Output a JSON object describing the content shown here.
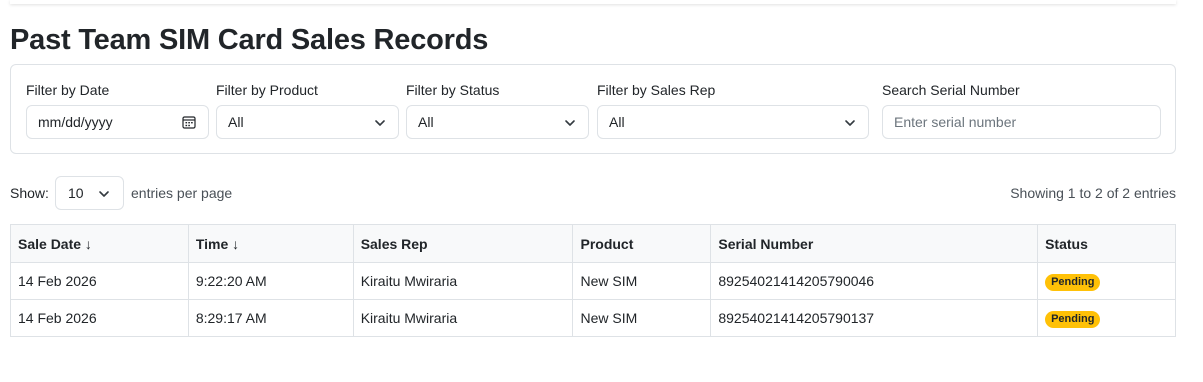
{
  "page": {
    "title": "Past Team SIM Card Sales Records"
  },
  "filters": {
    "date": {
      "label": "Filter by Date",
      "placeholder": "mm/dd/yyyy"
    },
    "product": {
      "label": "Filter by Product",
      "value": "All"
    },
    "status": {
      "label": "Filter by Status",
      "value": "All"
    },
    "sales_rep": {
      "label": "Filter by Sales Rep",
      "value": "All"
    },
    "serial": {
      "label": "Search Serial Number",
      "placeholder": "Enter serial number"
    }
  },
  "pagination": {
    "show_label": "Show:",
    "page_size": "10",
    "entries_label": "entries per page",
    "info": "Showing 1 to 2 of 2 entries"
  },
  "table": {
    "headers": [
      "Sale Date ↓",
      "Time ↓",
      "Sales Rep",
      "Product",
      "Serial Number",
      "Status"
    ],
    "rows": [
      [
        "14 Feb 2026",
        "9:22:20 AM",
        "Kiraitu Mwiraria",
        "New SIM",
        "89254021414205790046",
        "Pending"
      ],
      [
        "14 Feb 2026",
        "8:29:17 AM",
        "Kiraitu Mwiraria",
        "New SIM",
        "89254021414205790137",
        "Pending"
      ]
    ]
  },
  "colors": {
    "pending_badge": "#ffc107",
    "border": "#dee2e6",
    "header_bg": "#f8f9fa"
  },
  "icons": {
    "date": "calendar-icon",
    "select": "chevron-down-icon"
  }
}
